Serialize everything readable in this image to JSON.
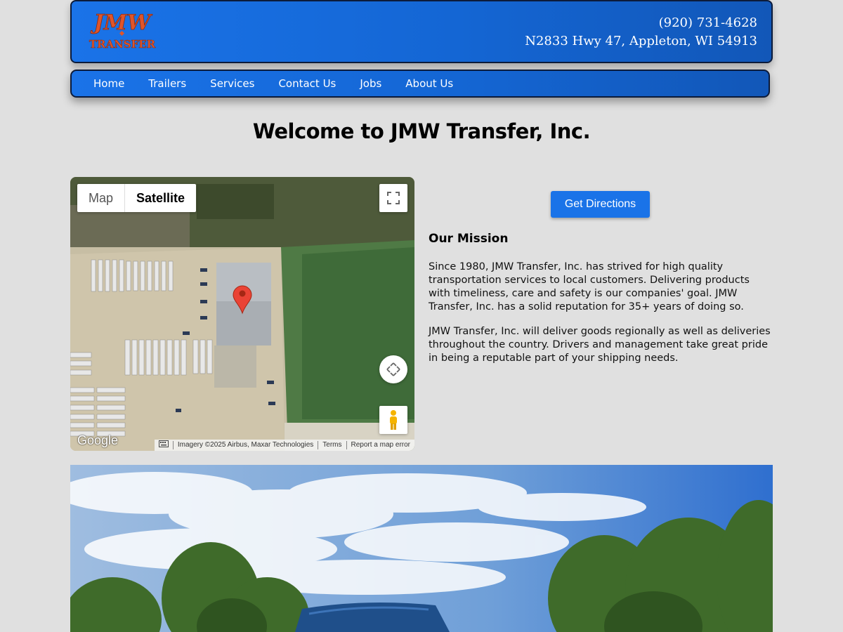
{
  "header": {
    "logo_text_top": "JMW",
    "logo_text_bottom": "TRANSFER",
    "phone": "(920) 731-4628",
    "address": "N2833 Hwy 47, Appleton, WI 54913"
  },
  "nav": {
    "items": [
      {
        "label": "Home"
      },
      {
        "label": "Trailers"
      },
      {
        "label": "Services"
      },
      {
        "label": "Contact Us"
      },
      {
        "label": "Jobs"
      },
      {
        "label": "About Us"
      }
    ]
  },
  "main": {
    "title": "Welcome to JMW Transfer, Inc."
  },
  "map": {
    "type_map_label": "Map",
    "type_satellite_label": "Satellite",
    "google_label": "Google",
    "imagery_credit": "Imagery ©2025 Airbus, Maxar Technologies",
    "terms_label": "Terms",
    "report_label": "Report a map error"
  },
  "directions_button": "Get Directions",
  "mission": {
    "heading": "Our Mission",
    "paragraph1": "Since 1980, JMW Transfer, Inc. has strived for high quality transportation services to local customers. Delivering products with timeliness, care and safety is our companies' goal. JMW Transfer, Inc. has a solid reputation for 35+ years of doing so.",
    "paragraph2": "JMW Transfer, Inc. will deliver goods regionally as well as deliveries throughout the country. Drivers and management take great pride in being a reputable part of your shipping needs."
  },
  "colors": {
    "brand_blue": "#1a73e8",
    "page_bg": "#e0e0e0",
    "logo_orange": "#e0552a"
  }
}
